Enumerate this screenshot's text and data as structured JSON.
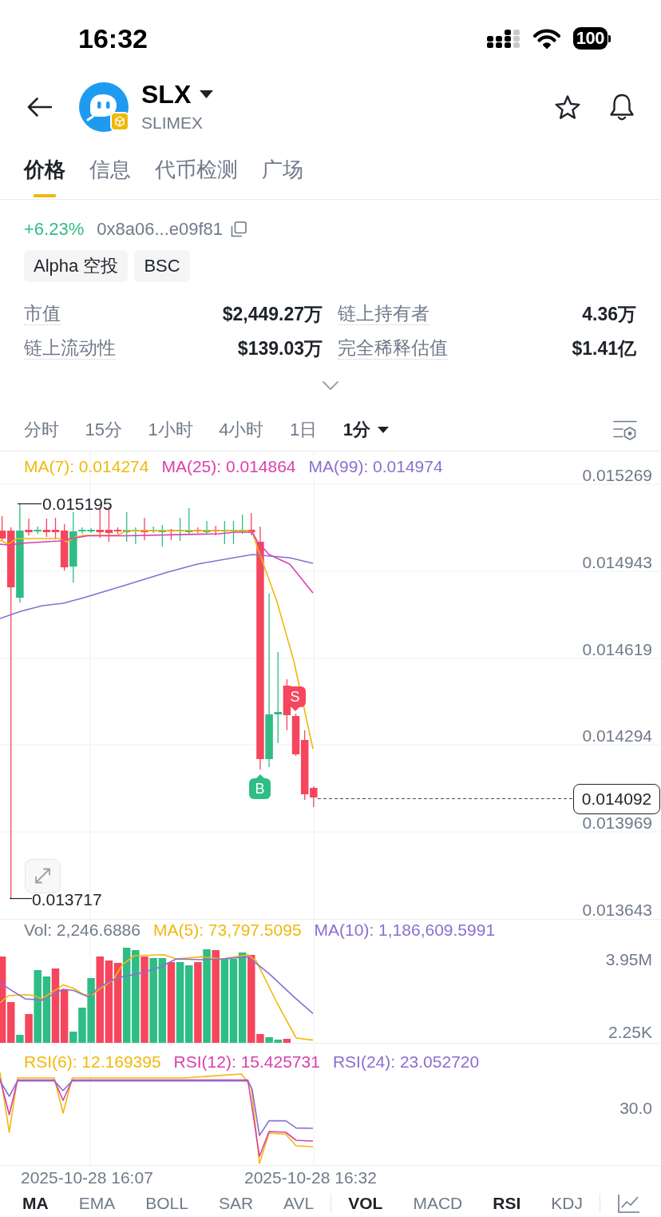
{
  "status_bar": {
    "time": "16:32",
    "battery": "100"
  },
  "header": {
    "symbol": "SLX",
    "name": "SLIMEX"
  },
  "tabs": [
    {
      "label": "价格",
      "selected": true
    },
    {
      "label": "信息",
      "selected": false
    },
    {
      "label": "代币检测",
      "selected": false
    },
    {
      "label": "广场",
      "selected": false
    }
  ],
  "token": {
    "change": "+6.23%",
    "address": "0x8a06...e09f81",
    "tags": [
      "Alpha 空投",
      "BSC"
    ],
    "stats": [
      {
        "label": "市值",
        "value": "$2,449.27万"
      },
      {
        "label": "链上持有者",
        "value": "4.36万"
      },
      {
        "label": "链上流动性",
        "value": "$139.03万"
      },
      {
        "label": "完全稀释估值",
        "value": "$1.41亿"
      }
    ]
  },
  "intervals": [
    {
      "label": "分时",
      "selected": false,
      "kind": "tab"
    },
    {
      "label": "15分",
      "selected": false,
      "kind": "tab"
    },
    {
      "label": "1小时",
      "selected": false,
      "kind": "tab"
    },
    {
      "label": "4小时",
      "selected": false,
      "kind": "tab"
    },
    {
      "label": "1日",
      "selected": false,
      "kind": "tab"
    },
    {
      "label": "1分",
      "selected": true,
      "kind": "dropdown"
    }
  ],
  "price_chart": {
    "legend": [
      {
        "text": "MA(7): 0.014274",
        "color": "#f0b90b"
      },
      {
        "text": "MA(25): 0.014864",
        "color": "#d93fae"
      },
      {
        "text": "MA(99): 0.014974",
        "color": "#8a6fd1"
      }
    ],
    "axis_labels": [
      "0.015269",
      "0.014943",
      "0.014619",
      "0.014294",
      "0.013969",
      "0.013643"
    ],
    "high_label": "0.015195",
    "low_label": "0.013717",
    "last_price": "0.014092",
    "markers": [
      {
        "kind": "buy",
        "label": "B"
      },
      {
        "kind": "sell",
        "label": "S"
      }
    ]
  },
  "volume_chart": {
    "legend": [
      {
        "text": "Vol: 2,246.6886",
        "color": "#707a8a"
      },
      {
        "text": "MA(5): 73,797.5095",
        "color": "#f0b90b"
      },
      {
        "text": "MA(10): 1,186,609.5991",
        "color": "#8a6fd1"
      }
    ],
    "axis_labels": [
      "3.95M",
      "2.25K"
    ]
  },
  "rsi_chart": {
    "legend": [
      {
        "text": "RSI(6): 12.169395",
        "color": "#f0b90b"
      },
      {
        "text": "RSI(12): 15.425731",
        "color": "#d93fae"
      },
      {
        "text": "RSI(24): 23.052720",
        "color": "#8a6fd1"
      }
    ],
    "axis_labels": [
      "30.0"
    ]
  },
  "time_axis": [
    "2025-10-28 16:07",
    "2025-10-28 16:32"
  ],
  "indicator_tabs": {
    "main": [
      {
        "label": "MA",
        "selected": true
      },
      {
        "label": "EMA",
        "selected": false
      },
      {
        "label": "BOLL",
        "selected": false
      },
      {
        "label": "SAR",
        "selected": false
      },
      {
        "label": "AVL",
        "selected": false
      }
    ],
    "sub": [
      {
        "label": "VOL",
        "selected": true
      },
      {
        "label": "MACD",
        "selected": false
      },
      {
        "label": "RSI",
        "selected": true
      },
      {
        "label": "KDJ",
        "selected": false
      }
    ]
  }
}
